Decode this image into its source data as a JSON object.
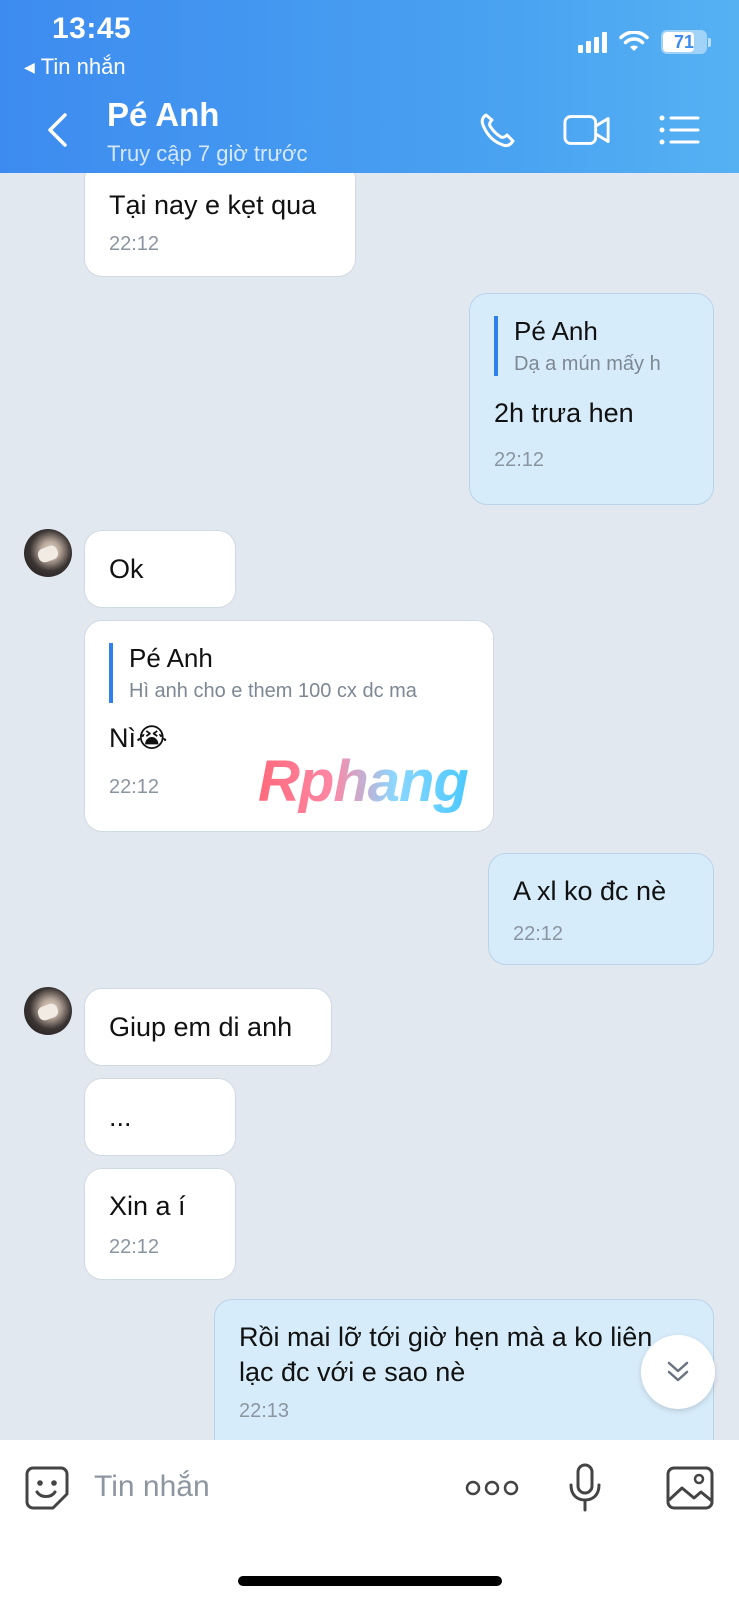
{
  "status_bar": {
    "time": "13:45",
    "back_app": "Tin nhắn",
    "battery": "71"
  },
  "header": {
    "name": "Pé Anh",
    "status": "Truy cập 7 giờ trước",
    "icons": [
      "back-icon",
      "phone-icon",
      "video-call-icon",
      "menu-list-icon"
    ]
  },
  "messages": [
    {
      "side": "them",
      "text": "Tại nay e kẹt qua",
      "time": "22:12"
    },
    {
      "side": "me",
      "reply_name": "Pé Anh",
      "reply_text": "Dạ a mún mấy h",
      "text": "2h trưa hen",
      "time": "22:12"
    },
    {
      "side": "them",
      "text": "Ok"
    },
    {
      "side": "them",
      "reply_name": "Pé Anh",
      "reply_text": "Hì anh cho e them 100 cx dc ma",
      "text": "Nì😭",
      "time": "22:12"
    },
    {
      "side": "me",
      "text": "A xl ko đc nè",
      "time": "22:12"
    },
    {
      "side": "them",
      "text": "Giup em di anh"
    },
    {
      "side": "them",
      "text": "..."
    },
    {
      "side": "them",
      "text": "Xin a í",
      "time": "22:12"
    },
    {
      "side": "me",
      "text_line1": "Rồi mai lỡ tới giờ hẹn mà a ko liên",
      "text_line2": "lạc đc với e sao nè",
      "time": "22:13"
    }
  ],
  "watermark": "Rphang",
  "composer": {
    "placeholder": "Tin nhắn",
    "icons": [
      "sticker-icon",
      "more-icon",
      "microphone-icon",
      "image-icon"
    ]
  },
  "colors": {
    "header_start": "#3d8bf0",
    "header_end": "#56b1f3",
    "my_bubble": "#d7ecfa",
    "their_bubble": "#ffffff",
    "chat_bg": "#e2e8f0"
  }
}
